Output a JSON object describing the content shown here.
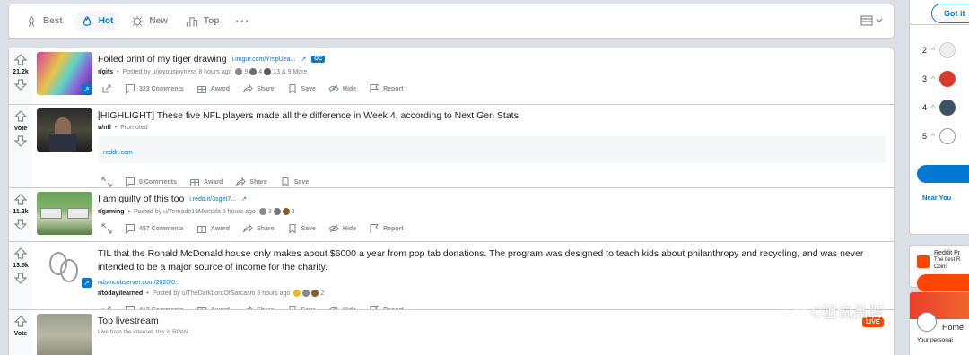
{
  "sort_bar": {
    "tabs": [
      {
        "label": "Best",
        "icon": "rocket-icon",
        "active": false
      },
      {
        "label": "Hot",
        "icon": "flame-icon",
        "active": true
      },
      {
        "label": "New",
        "icon": "sparkle-icon",
        "active": false
      },
      {
        "label": "Top",
        "icon": "podium-icon",
        "active": false
      }
    ],
    "more": "···",
    "layout_icon": "card-view-icon"
  },
  "posts": [
    {
      "votes": "21.2k",
      "title": "Foiled print of my tiger drawing",
      "domain": "i.imgur.com/YmpUea...",
      "badge": "OC",
      "subreddit": "r/gifs",
      "byline": "Posted by u/joyousjoyness 8 hours ago",
      "awards": [
        "9",
        "4",
        "13",
        "& 9 More"
      ],
      "actions": [
        "323 Comments",
        "Award",
        "Share",
        "Save",
        "Hide",
        "Report"
      ]
    },
    {
      "votes": "Vote",
      "title": "[HIGHLIGHT] These five NFL players made all the difference in Week 4, according to Next Gen Stats",
      "subreddit": "u/nfl",
      "byline": "Promoted",
      "link": "reddit.com",
      "actions": [
        "0 Comments",
        "Award",
        "Share",
        "Save"
      ]
    },
    {
      "votes": "11.2k",
      "title": "I am guilty of this too",
      "domain": "i.redd.it/3sget7...",
      "subreddit": "r/gaming",
      "byline": "Posted by u/Tornado18Mustafa 6 hours ago",
      "awards": [
        "3",
        "2"
      ],
      "actions": [
        "457 Comments",
        "Award",
        "Share",
        "Save",
        "Hide",
        "Report"
      ]
    },
    {
      "votes": "13.5k",
      "title": "TIL that the Ronald McDonald house only makes about $6000 a year from pop tab donations. The program was designed to teach kids about philanthropy and recycling, and was never intended to be a major source of income for the charity.",
      "domain": "ndsmcobserver.com/2020/0...",
      "subreddit": "r/todayilearned",
      "byline": "Posted by u/TheDarkLordOfSarcasm 8 hours ago",
      "awards": [
        "2"
      ],
      "actions": [
        "412 Comments",
        "Award",
        "Share",
        "Save",
        "Hide",
        "Report"
      ]
    },
    {
      "votes": "Vote",
      "title": "Top livestream",
      "subtitle": "Live from the internet, this is RPAN",
      "live": "LIVE"
    }
  ],
  "sidebar": {
    "got_it": "Got it",
    "ranks": [
      "2",
      "3",
      "4",
      "5"
    ],
    "near_you": "Near You",
    "premium_title": "Reddit Pr",
    "premium_text_1": "The best R",
    "premium_text_2": "Coins",
    "home": "Home",
    "home_sub": "Your personal"
  },
  "watermark": "C姐说品牌",
  "colors": {
    "accent": "#0079d3",
    "orange": "#ff4500",
    "background": "#dae0e6"
  }
}
